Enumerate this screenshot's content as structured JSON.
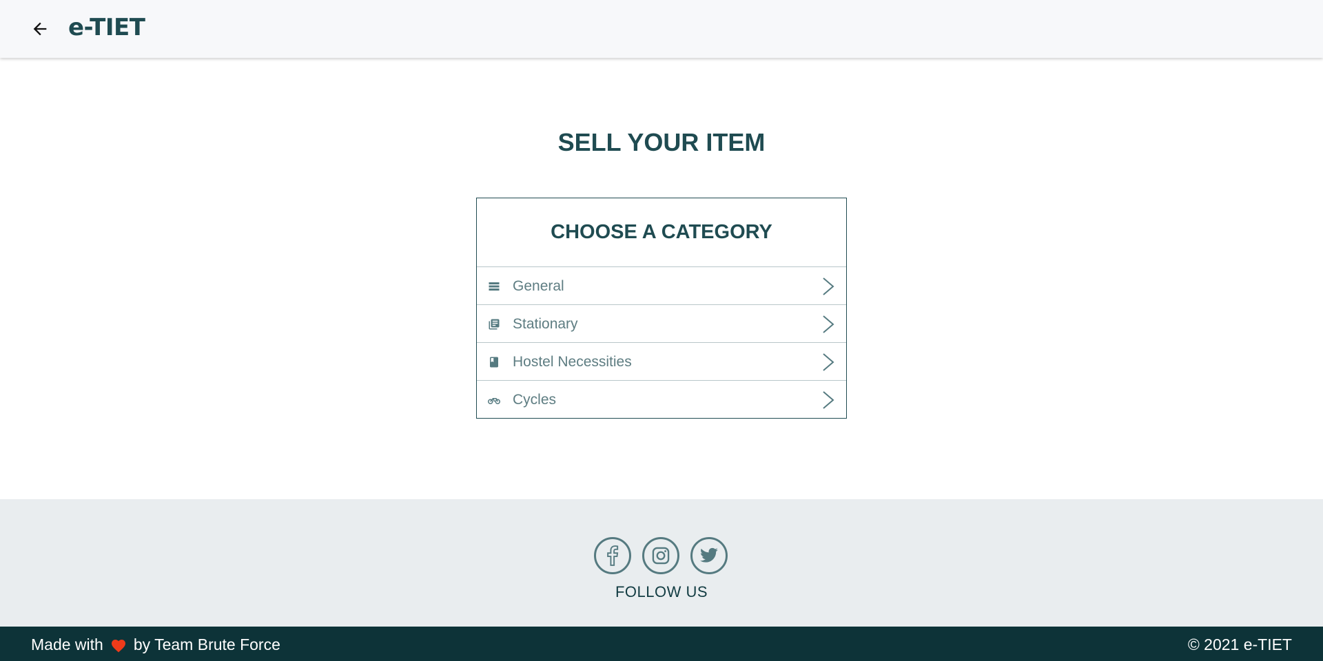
{
  "header": {
    "brand": "e-TIET",
    "back_icon": "arrow-left-icon"
  },
  "main": {
    "title": "SELL YOUR ITEM",
    "card_title": "CHOOSE A CATEGORY",
    "categories": [
      {
        "label": "General",
        "icon": "storage-icon"
      },
      {
        "label": "Stationary",
        "icon": "library-books-icon"
      },
      {
        "label": "Hostel Necessities",
        "icon": "book-icon"
      },
      {
        "label": "Cycles",
        "icon": "bicycle-icon"
      }
    ]
  },
  "footer": {
    "social": [
      "facebook-icon",
      "instagram-icon",
      "twitter-icon"
    ],
    "follow_label": "FOLLOW US",
    "made_with_prefix": "Made with",
    "made_with_suffix": "by Team Brute Force",
    "copyright": "© 2021 e-TIET"
  },
  "colors": {
    "brand": "#1f4b51",
    "footer_bg": "#e9edef",
    "bottombar_bg": "#0d3338",
    "heart": "#ee3b1a"
  }
}
